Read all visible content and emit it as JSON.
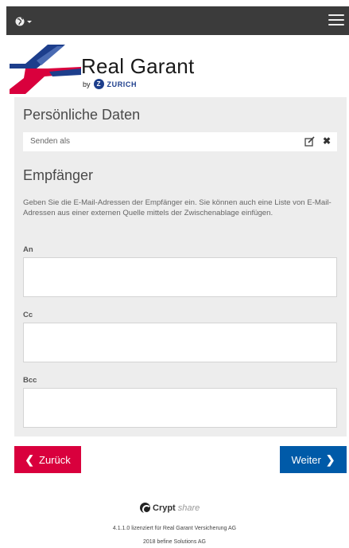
{
  "header": {
    "language_icon": "globe-icon",
    "menu_icon": "hamburger-icon"
  },
  "brand": {
    "name": "Real Garant",
    "by": "by",
    "partner": "ZURICH",
    "colors": {
      "red": "#d9003d",
      "blue": "#1d3e8c"
    }
  },
  "personal": {
    "title": "Persönliche Daten",
    "sender_label": "Senden als"
  },
  "recipients": {
    "title": "Empfänger",
    "description": "Geben Sie die E-Mail-Adressen der Empfänger ein. Sie können auch eine Liste von E-Mail-Adressen aus einer externen Quelle mittels der Zwischenablage einfügen.",
    "to_label": "An",
    "cc_label": "Cc",
    "bcc_label": "Bcc",
    "to_value": "",
    "cc_value": "",
    "bcc_value": ""
  },
  "buttons": {
    "back": "Zurück",
    "next": "Weiter",
    "back_color": "#d9003d",
    "next_color": "#005aa8"
  },
  "footer": {
    "product_main": "Crypt",
    "product_suffix": "share",
    "version_line": "4.1.1.0 lizenziert für Real Garant Versicherung AG",
    "copyright_line": "2018 befine Solutions AG"
  }
}
